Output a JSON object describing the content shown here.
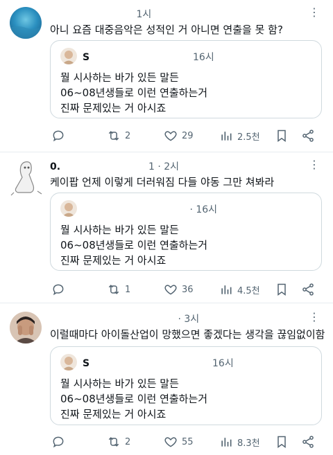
{
  "quoted": {
    "name": "S",
    "time": "16시",
    "lines": [
      "뭘 시사하는 바가 있든 말든",
      "06~08년생들로 이런 연출하는거",
      "진짜 문제있는 거 아시죠"
    ]
  },
  "posts": [
    {
      "name": "",
      "time": "1시",
      "text": "아니 요즘 대중음악은 성적인 거 아니면 연출을 못 함?",
      "quote_name": "S",
      "quote_time": "16시",
      "replies": "",
      "reposts": "2",
      "likes": "29",
      "views": "2.5천"
    },
    {
      "name": "0.",
      "time": "1 · 2시",
      "text": "케이팝 언제 이렇게 더러워짐 다들 야동 그만 쳐봐라",
      "quote_name": "",
      "quote_time": "· 16시",
      "replies": "",
      "reposts": "1",
      "likes": "36",
      "views": "4.5천"
    },
    {
      "name": "",
      "time": "· 3시",
      "text": "이럴때마다 아이돌산업이 망했으면 좋겠다는 생각을 끊임없이함",
      "quote_name": "S",
      "quote_time": "16시",
      "replies": "",
      "reposts": "2",
      "likes": "55",
      "views": "8.3천"
    }
  ],
  "colors": {
    "text": "#0f1419",
    "muted": "#536471",
    "border": "#cfd9de",
    "divider": "#e6ecf0"
  }
}
